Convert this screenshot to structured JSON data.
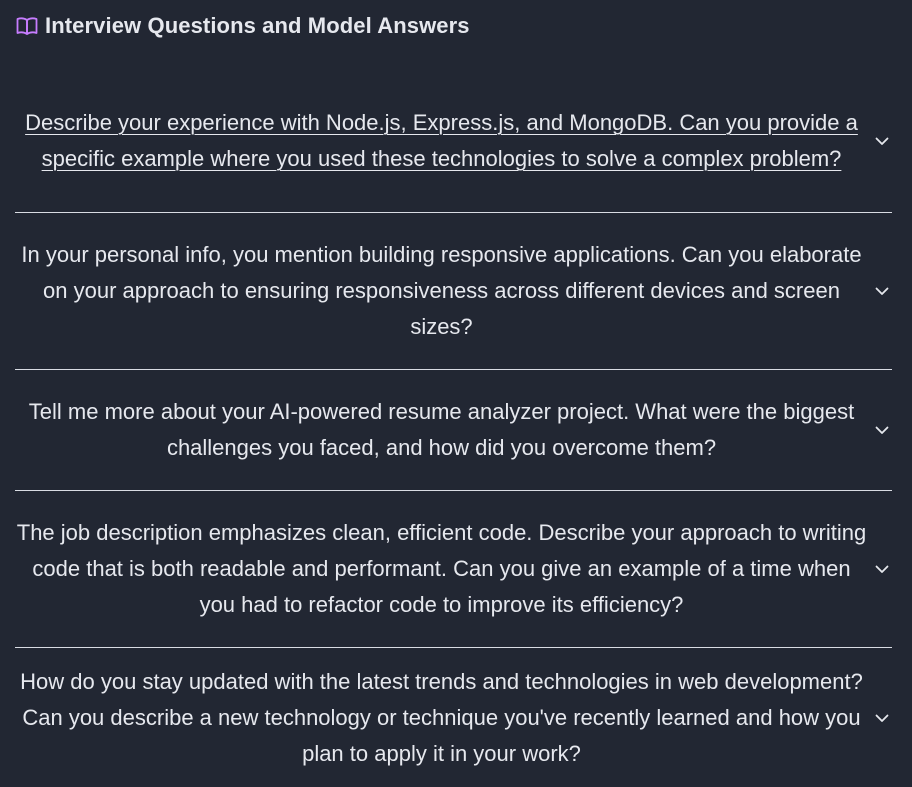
{
  "header": {
    "title": "Interview Questions and Model Answers",
    "icon": "book-open-icon",
    "icon_color": "#c77dff"
  },
  "questions": [
    {
      "text": "Describe your experience with Node.js, Express.js, and MongoDB. Can you provide a specific example where you used these technologies to solve a complex problem?",
      "active": true,
      "icon": "chevron-down-icon"
    },
    {
      "text": "In your personal info, you mention building responsive applications. Can you elaborate on your approach to ensuring responsiveness across different devices and screen sizes?",
      "active": false,
      "icon": "chevron-down-icon"
    },
    {
      "text": "Tell me more about your AI-powered resume analyzer project. What were the biggest challenges you faced, and how did you overcome them?",
      "active": false,
      "icon": "chevron-down-icon"
    },
    {
      "text": "The job description emphasizes clean, efficient code. Describe your approach to writing code that is both readable and performant. Can you give an example of a time when you had to refactor code to improve its efficiency?",
      "active": false,
      "icon": "chevron-down-icon"
    },
    {
      "text": "How do you stay updated with the latest trends and technologies in web development? Can you describe a new technology or technique you've recently learned and how you plan to apply it in your work?",
      "active": false,
      "icon": "chevron-down-icon"
    }
  ],
  "colors": {
    "background": "#222733",
    "text": "#e6e8ee",
    "divider": "#d9dce3",
    "accent": "#c77dff"
  }
}
